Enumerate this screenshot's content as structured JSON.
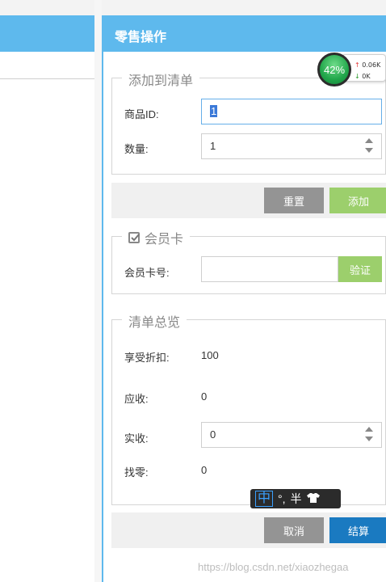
{
  "panel": {
    "title": "零售操作"
  },
  "add_section": {
    "legend": "添加到清单",
    "product_id_label": "商品ID:",
    "product_id_value": "1",
    "quantity_label": "数量:",
    "quantity_value": "1",
    "reset_label": "重置",
    "add_label": "添加"
  },
  "member_section": {
    "legend": "会员卡",
    "card_label": "会员卡号:",
    "card_value": "",
    "verify_label": "验证"
  },
  "summary_section": {
    "legend": "清单总览",
    "discount_label": "享受折扣:",
    "discount_value": "100",
    "receivable_label": "应收:",
    "receivable_value": "0",
    "paid_label": "实收:",
    "paid_value": "0",
    "change_label": "找零:",
    "change_value": "0",
    "cancel_label": "取消",
    "checkout_label": "结算"
  },
  "net_widget": {
    "percent": "42%",
    "upload": "0.06K",
    "download": "0K"
  },
  "ime": {
    "mode": "中",
    "punct": "°,",
    "width": "半"
  },
  "watermark": "https://blog.csdn.net/xiaozhegaa",
  "colors": {
    "header": "#5eb9ed",
    "green": "#9ccf6c",
    "blue": "#1a7ac1",
    "gray": "#949494"
  }
}
